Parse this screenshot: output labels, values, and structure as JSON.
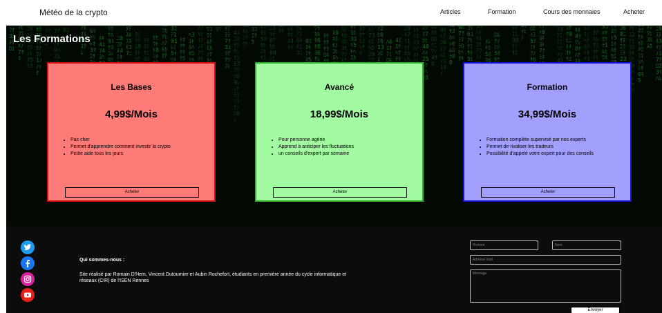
{
  "header": {
    "brand": "Météo de la crypto",
    "nav": [
      "Articles",
      "Formation",
      "Cours des monnaies",
      "Acheter"
    ]
  },
  "formations": {
    "title": "Les Formations",
    "cards": [
      {
        "name": "Les Bases",
        "price": "4,99$/Mois",
        "color": "#ff7b78",
        "border": "#d51010",
        "features": [
          "Pas cher",
          "Permet d'apprendre comment investir la crypto",
          "Petite aide tous les jours"
        ],
        "button": "Acheter"
      },
      {
        "name": "Avancé",
        "price": "18,99$/Mois",
        "color": "#a2fba0",
        "border": "#2eb52a",
        "features": [
          "Pour personne agérie",
          "Apprend à anticiper les fluctuations",
          "un conseils d'expert par semaine"
        ],
        "button": "Acheter"
      },
      {
        "name": "Formation",
        "price": "34,99$/Mois",
        "color": "#a39ffc",
        "border": "#1a14d8",
        "features": [
          "Formation complète supervisé par nos experts",
          "Permet de rivaliser les tradeurs",
          "Possibilité d'appelé votre expert pour des conseils"
        ],
        "button": "Acheter"
      }
    ]
  },
  "footer": {
    "social": [
      "twitter-icon",
      "facebook-icon",
      "instagram-icon",
      "youtube-icon"
    ],
    "about_title": "Qui sommes-nous :",
    "about_text": "Site réalisé par Romain D'Hem, Vincent Dutournier et Aubin Rochefort, étudiants en première année du cycle informatique et réseaux (CIR) de l'ISEN Rennes",
    "form": {
      "firstname_placeholder": "Prénom",
      "lastname_placeholder": "Nom",
      "email_placeholder": "Adresse mail",
      "message_placeholder": "Message",
      "send": "Envoyer"
    }
  }
}
